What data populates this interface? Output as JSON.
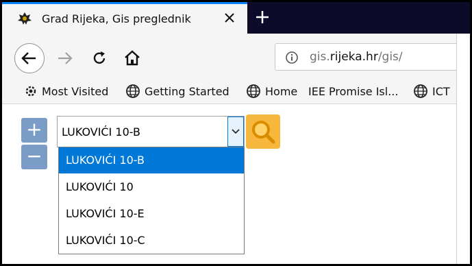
{
  "browser": {
    "tab": {
      "title": "Grad Rijeka, Gis preglednik"
    },
    "address": {
      "protocol_path_prefix": "gis.",
      "domain": "rijeka.hr",
      "path": "/gis/"
    },
    "bookmarks": [
      {
        "label": "Most Visited",
        "icon": "gear-icon"
      },
      {
        "label": "Getting Started",
        "icon": "globe-icon"
      },
      {
        "label": "Home",
        "icon": "globe-icon"
      },
      {
        "label": "IEE Promise Isl...",
        "icon": "none"
      },
      {
        "label": "ICT",
        "icon": "globe-icon"
      }
    ]
  },
  "map_controls": {
    "zoom_in_label": "+",
    "zoom_out_label": "−"
  },
  "search": {
    "selected_value": "LUKOVIĆI 10-B",
    "options": [
      "LUKOVIĆI 10-B",
      "LUKOVIĆI 10",
      "LUKOVIĆI 10-E",
      "LUKOVIĆI 10-C"
    ],
    "highlighted_index": 0
  },
  "colors": {
    "tab_accent": "#0a84ff",
    "zoom_button": "#7b9cc7",
    "search_button": "#f6b73c",
    "dropdown_highlight": "#0078d7"
  }
}
